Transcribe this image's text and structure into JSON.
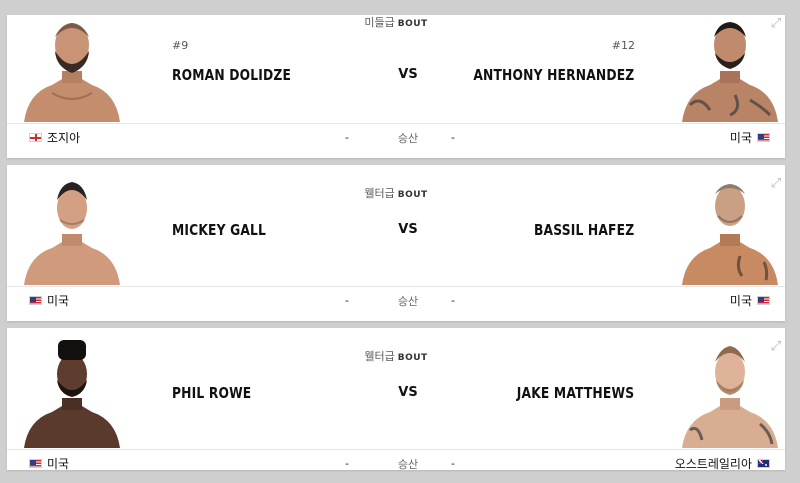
{
  "fights": [
    {
      "weight_class": "미들급",
      "bout_tag": "BOUT",
      "vs": "VS",
      "result": "승산",
      "red": {
        "rank": "#9",
        "name": "ROMAN DOLIDZE",
        "country": "조지아",
        "flag": "georgia-flag-icon",
        "odds": "-"
      },
      "blue": {
        "rank": "#12",
        "name": "ANTHONY HERNANDEZ",
        "country": "미국",
        "flag": "us-flag-icon",
        "odds": "-"
      }
    },
    {
      "weight_class": "웰터급",
      "bout_tag": "BOUT",
      "vs": "VS",
      "result": "승산",
      "red": {
        "rank": "",
        "name": "MICKEY GALL",
        "country": "미국",
        "flag": "us-flag-icon",
        "odds": "-"
      },
      "blue": {
        "rank": "",
        "name": "BASSIL HAFEZ",
        "country": "미국",
        "flag": "us-flag-icon",
        "odds": "-"
      }
    },
    {
      "weight_class": "웰터급",
      "bout_tag": "BOUT",
      "vs": "VS",
      "result": "승산",
      "red": {
        "rank": "",
        "name": "PHIL ROWE",
        "country": "미국",
        "flag": "us-flag-icon",
        "odds": "-"
      },
      "blue": {
        "rank": "",
        "name": "JAKE MATTHEWS",
        "country": "오스트레일리아",
        "flag": "australia-flag-icon",
        "odds": "-"
      }
    }
  ],
  "icons": {
    "expand": "expand-icon"
  },
  "colors": {
    "page_bg": "#cfcfcf",
    "card_bg": "#ffffff",
    "text": "#111111"
  }
}
